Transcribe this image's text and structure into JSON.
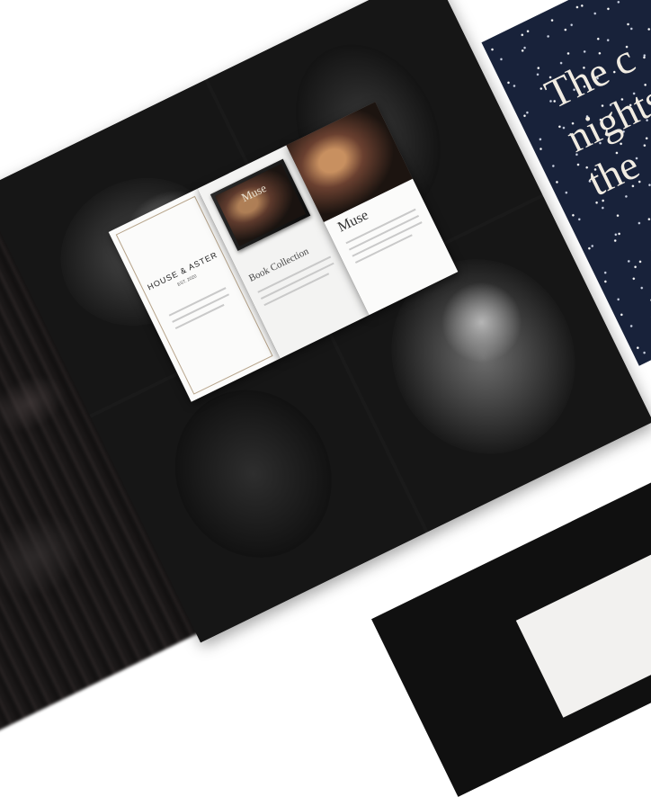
{
  "brochure": {
    "brand": "HOUSE & ASTER",
    "brand_sub": "EST. 2020",
    "section_title": "Book Collection",
    "magazine_title": "Muse",
    "panel_title": "Muse"
  },
  "star_panel": {
    "text": "The c\nnights\nthe"
  },
  "colors": {
    "background": "#ffffff",
    "collage": "#1a1a1a",
    "star_sky": "#18223a",
    "frame_accent": "#b7a48a"
  }
}
